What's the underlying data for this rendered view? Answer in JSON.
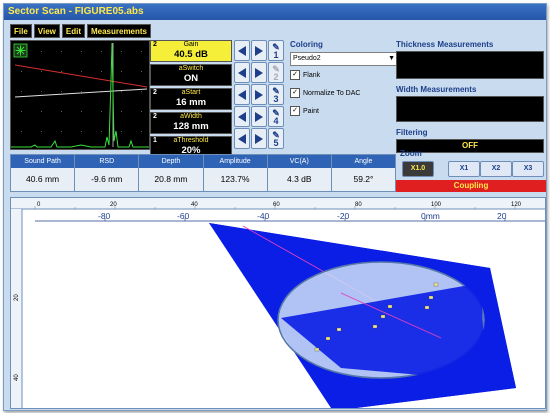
{
  "window": {
    "title": "Sector Scan - FIGURE05.abs"
  },
  "menu": [
    "File",
    "View",
    "Edit",
    "Measurements"
  ],
  "params": [
    {
      "num": "2",
      "label": "Gain",
      "value": "40.5 dB",
      "active": true
    },
    {
      "num": "",
      "label": "aSwitch",
      "value": "ON",
      "active": false
    },
    {
      "num": "2",
      "label": "aStart",
      "value": "16 mm",
      "active": false
    },
    {
      "num": "2",
      "label": "aWidth",
      "value": "128 mm",
      "active": false
    },
    {
      "num": "1",
      "label": "aThreshold",
      "value": "20%",
      "active": false
    }
  ],
  "nav_numbers": [
    "1",
    "2",
    "3",
    "4",
    "5"
  ],
  "coloring": {
    "label": "Coloring",
    "selected": "Pseudo2",
    "checks": [
      {
        "label": "Flank",
        "checked": true
      },
      {
        "label": "Normalize To DAC",
        "checked": true
      },
      {
        "label": "Paint",
        "checked": true
      }
    ]
  },
  "right": {
    "thickness_label": "Thickness Measurements",
    "width_label": "Width Measurements",
    "filtering_label": "Filtering",
    "filtering_value": "OFF",
    "zoom_label": "Zoom",
    "zoom_options": [
      "X1.0",
      "X1",
      "X2",
      "X3"
    ],
    "zoom_selected": "X1.0",
    "coupling": "Coupling"
  },
  "readouts": [
    {
      "label": "Sound Path",
      "value": "40.6 mm"
    },
    {
      "label": "RSD",
      "value": "-9.6 mm"
    },
    {
      "label": "Depth",
      "value": "20.8 mm"
    },
    {
      "label": "Amplitude",
      "value": "123.7%"
    },
    {
      "label": "VC(A)",
      "value": "4.3 dB"
    },
    {
      "label": "Angle",
      "value": "59.2°"
    }
  ],
  "ruler_top_small": [
    "0",
    "20",
    "40",
    "60",
    "80",
    "100",
    "120"
  ],
  "ruler_top_big": [
    "-80",
    "-60",
    "-40",
    "-20",
    "0mm",
    "20"
  ],
  "ruler_left": [
    "20",
    "40"
  ],
  "colors": {
    "accent": "#ffe94a",
    "fan": "#0a1ee6",
    "coupling": "#e02020"
  }
}
